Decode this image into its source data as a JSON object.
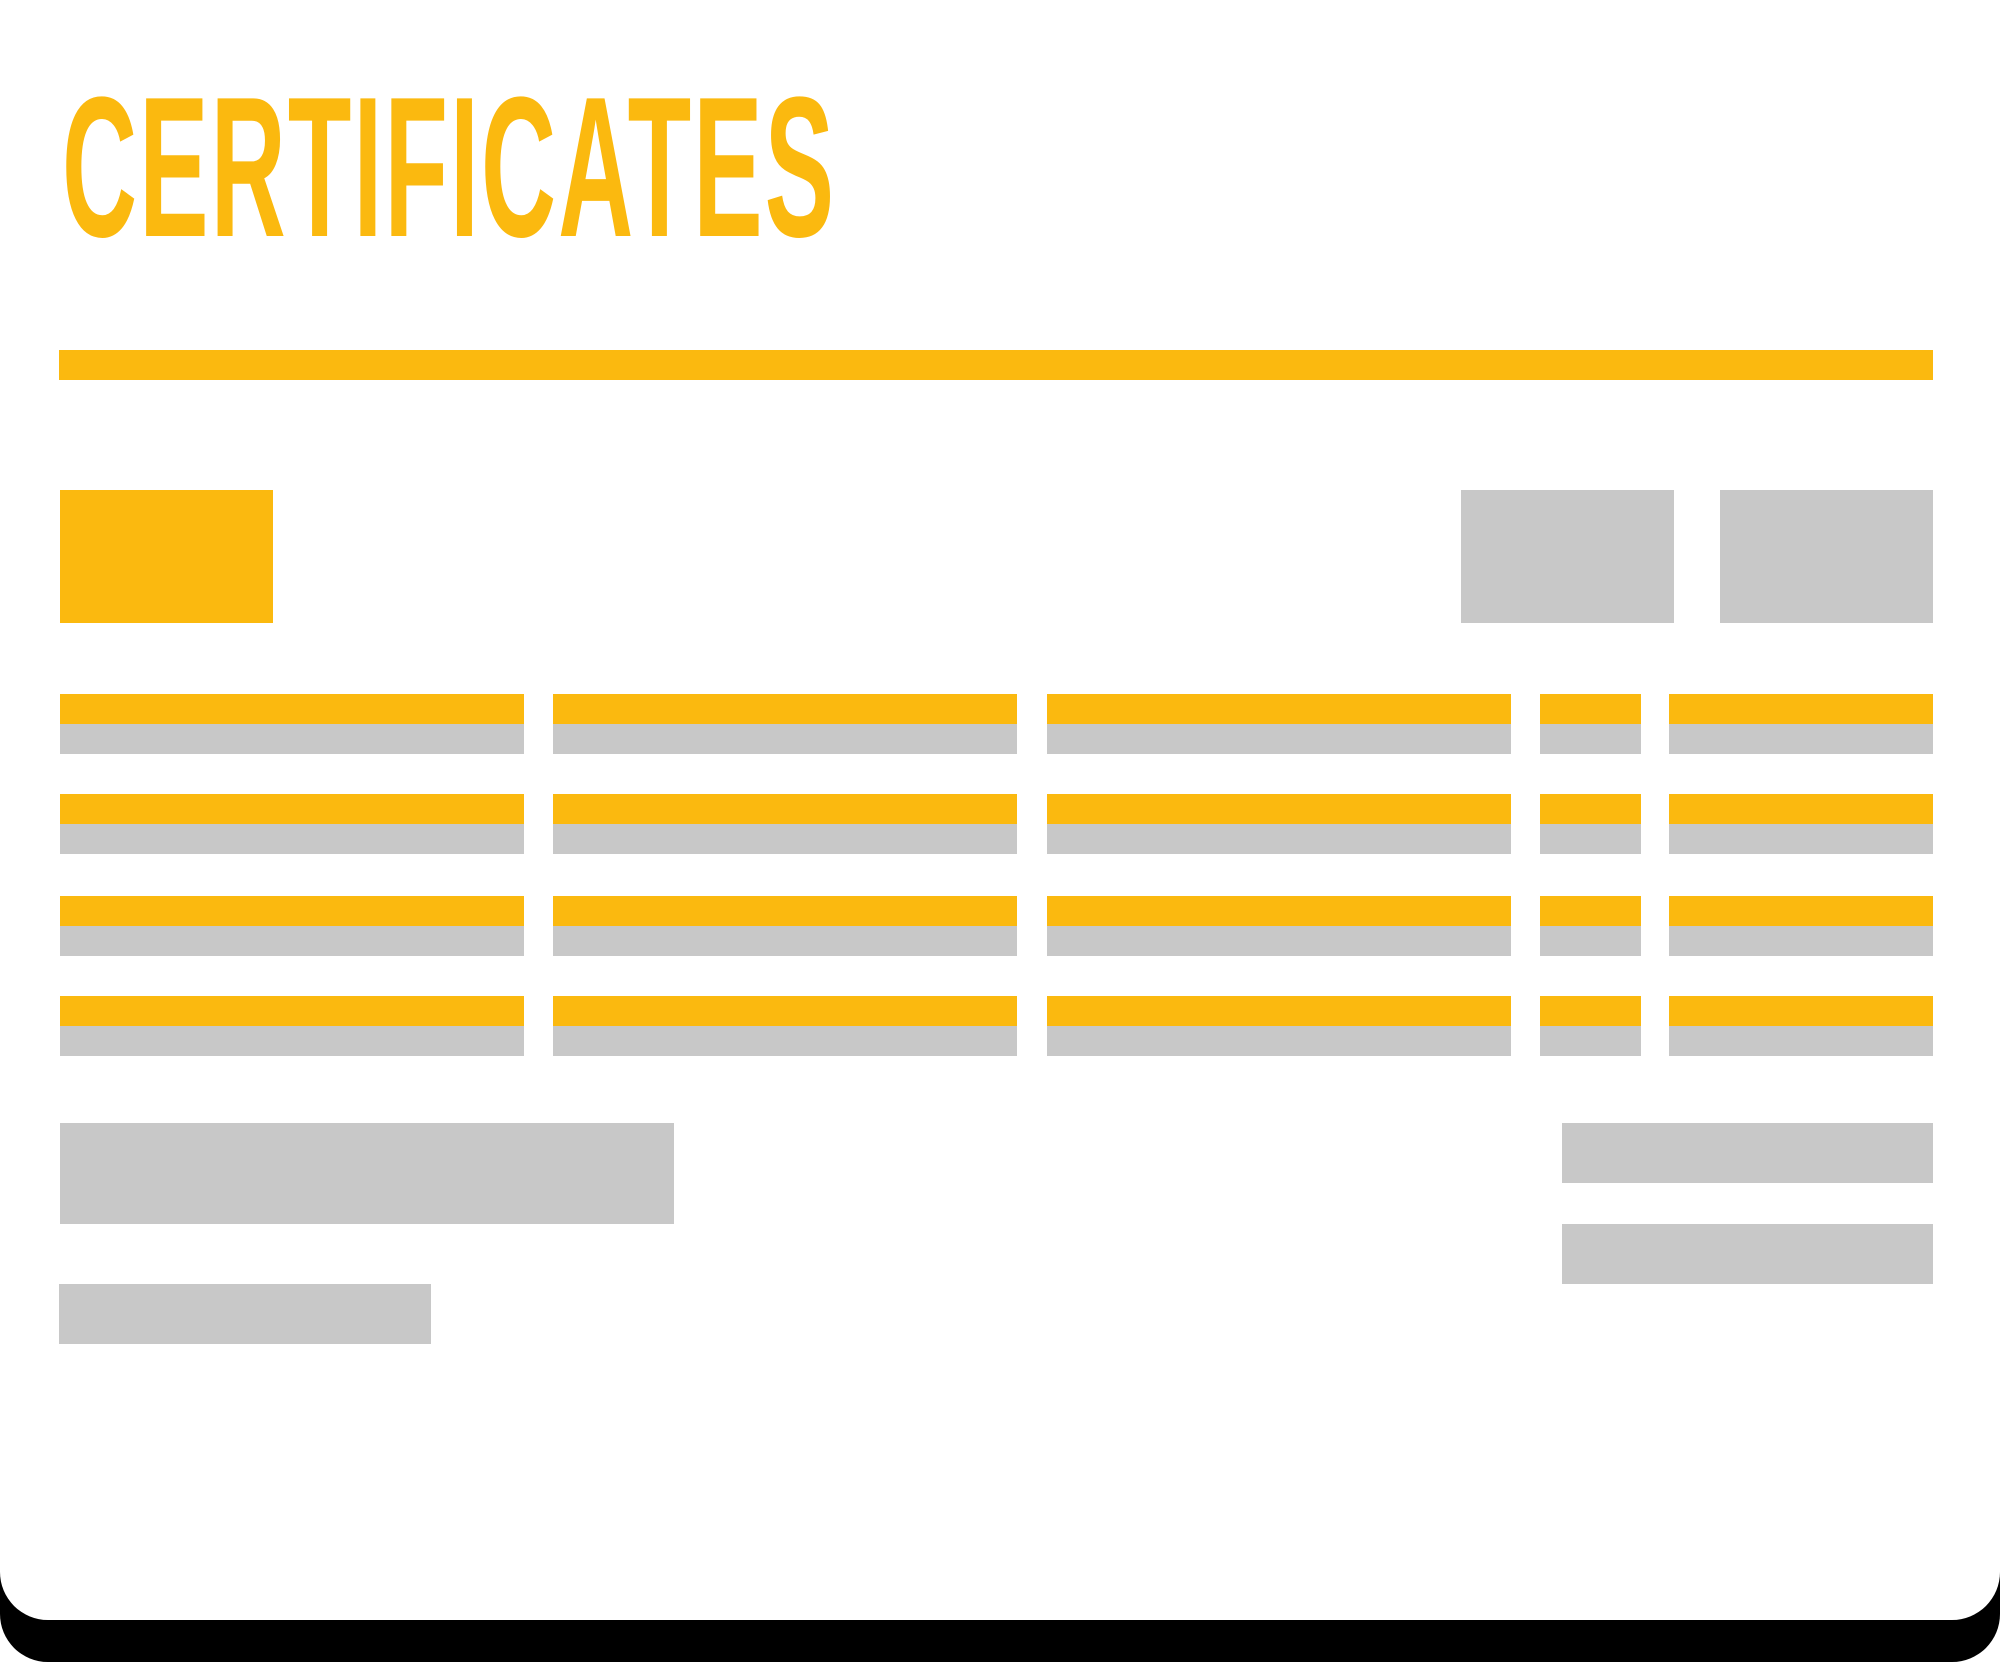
{
  "header": {
    "title": "CERTIFICATES"
  },
  "colors": {
    "accent": "#FBB90F",
    "placeholder": "#C8C8C8",
    "shadow": "#000000",
    "background": "#FFFFFF"
  },
  "table": {
    "rows": 4,
    "columns": 5
  }
}
